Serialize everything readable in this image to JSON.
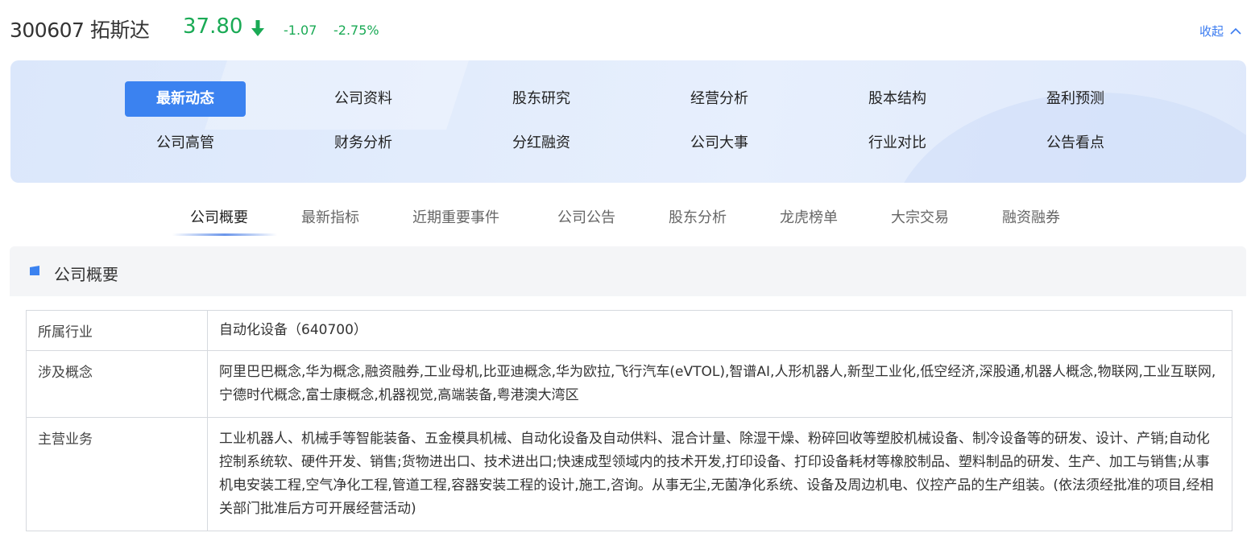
{
  "stock": {
    "code_name": "300607 拓斯达",
    "price": "37.80",
    "change": "-1.07",
    "change_pct": "-2.75%",
    "collapse_label": "收起",
    "colors": {
      "down": "#1aaa55",
      "link": "#3a7bf0",
      "accent": "#3b82f0"
    }
  },
  "nav": {
    "items": [
      {
        "label": "最新动态",
        "active": true
      },
      {
        "label": "公司资料"
      },
      {
        "label": "股东研究"
      },
      {
        "label": "经营分析"
      },
      {
        "label": "股本结构"
      },
      {
        "label": "盈利预测"
      },
      {
        "label": "公司高管"
      },
      {
        "label": "财务分析"
      },
      {
        "label": "分红融资"
      },
      {
        "label": "公司大事"
      },
      {
        "label": "行业对比"
      },
      {
        "label": "公告看点"
      }
    ]
  },
  "subtabs": [
    {
      "label": "公司概要",
      "active": true
    },
    {
      "label": "最新指标"
    },
    {
      "label": "近期重要事件"
    },
    {
      "label": "公司公告"
    },
    {
      "label": "股东分析"
    },
    {
      "label": "龙虎榜单"
    },
    {
      "label": "大宗交易"
    },
    {
      "label": "融资融券"
    }
  ],
  "section": {
    "title": "公司概要",
    "rows": [
      {
        "label": "所属行业",
        "value": "自动化设备（640700）"
      },
      {
        "label": "涉及概念",
        "value": "阿里巴巴概念,华为概念,融资融券,工业母机,比亚迪概念,华为欧拉,飞行汽车(eVTOL),智谱AI,人形机器人,新型工业化,低空经济,深股通,机器人概念,物联网,工业互联网,宁德时代概念,富士康概念,机器视觉,高端装备,粤港澳大湾区"
      },
      {
        "label": "主营业务",
        "value": "工业机器人、机械手等智能装备、五金模具机械、自动化设备及自动供料、混合计量、除湿干燥、粉碎回收等塑胶机械设备、制冷设备等的研发、设计、产销;自动化控制系统软、硬件开发、销售;货物进出口、技术进出口;快速成型领域内的技术开发,打印设备、打印设备耗材等橡胶制品、塑料制品的研发、生产、加工与销售;从事机电安装工程,空气净化工程,管道工程,容器安装工程的设计,施工,咨询。从事无尘,无菌净化系统、设备及周边机电、仪控产品的生产组装。(依法须经批准的项目,经相关部门批准后方可开展经营活动)"
      }
    ]
  }
}
